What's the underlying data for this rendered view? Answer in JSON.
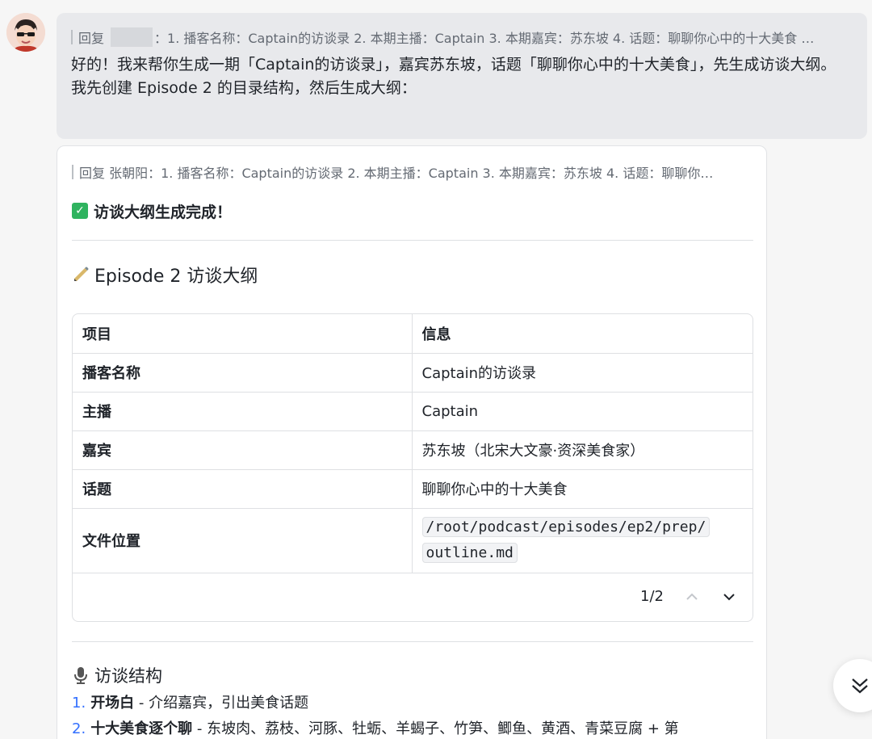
{
  "reply1": {
    "prefix": "回复",
    "text": "：1. 播客名称：Captain的访谈录 2. 本期主播：Captain 3. 本期嘉宾：苏东坡 4. 话题：聊聊你心中的十大美食 …"
  },
  "message": {
    "line1": "好的！我来帮你生成一期「Captain的访谈录」，嘉宾苏东坡，话题「聊聊你心中的十大美食」，先生成访谈大纲。",
    "line2": "我先创建 Episode 2 的目录结构，然后生成大纲："
  },
  "card": {
    "reply": "回复 张朝阳：1. 播客名称：Captain的访谈录 2. 本期主播：Captain 3. 本期嘉宾：苏东坡 4. 话题：聊聊你…",
    "done": "访谈大纲生成完成！",
    "outline_title": "Episode 2 访谈大纲",
    "table": {
      "headers": [
        "项目",
        "信息"
      ],
      "rows": [
        [
          "播客名称",
          "Captain的访谈录"
        ],
        [
          "主播",
          "Captain"
        ],
        [
          "嘉宾",
          "苏东坡（北宋大文豪·资深美食家）"
        ],
        [
          "话题",
          "聊聊你心中的十大美食"
        ]
      ],
      "file_label": "文件位置",
      "file_path_1": "/root/podcast/episodes/ep2/prep/",
      "file_path_2": "outline.md"
    },
    "pager": "1/2",
    "structure_title": "访谈结构",
    "structure": [
      {
        "num": "1.",
        "title": "开场白",
        "desc": " - 介绍嘉宾，引出美食话题"
      },
      {
        "num": "2.",
        "title": "十大美食逐个聊",
        "desc": " - 东坡肉、荔枝、河豚、牡蛎、羊蝎子、竹笋、鲫鱼、黄酒、青菜豆腐 + 第"
      }
    ]
  },
  "icons": {
    "check": "check-mark-icon",
    "pen": "pen-icon",
    "mic": "microphone-icon",
    "scroll": "double-chevron-down-icon"
  },
  "colors": {
    "bubble": "#e8e9ec",
    "accent_blue": "#3370ff",
    "check_green": "#2fb35f"
  }
}
